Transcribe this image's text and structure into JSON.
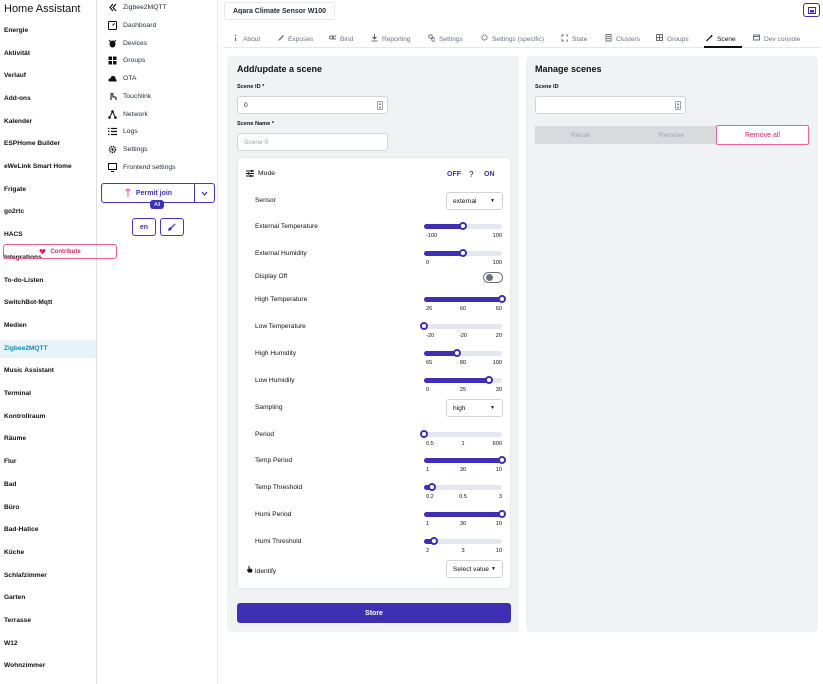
{
  "ha": {
    "title": "Home Assistant",
    "items": [
      "Energie",
      "Aktivität",
      "Verlauf",
      "Add-ons",
      "Kalender",
      "ESPHome Builder",
      "eWeLink Smart Home",
      "Frigate",
      "go2rtc",
      "HACS",
      "Integrations",
      "To-do-Listen",
      "SwitchBot-Mqtt",
      "Medien",
      "Zigbee2MQTT",
      "Music Assistant",
      "Terminal",
      "Kontrollraum",
      "Räume",
      "Flur",
      "Bad",
      "Büro",
      "Bad-Hatice",
      "Küche",
      "Schlafzimmer",
      "Garten",
      "Terrasse",
      "W12",
      "Wohnzimmer"
    ],
    "active_index": 14
  },
  "z2m": {
    "items": [
      {
        "label": "Zigbee2MQTT",
        "icon": "double-chevron-left-icon"
      },
      {
        "label": "Dashboard",
        "icon": "dashboard-icon"
      },
      {
        "label": "Devices",
        "icon": "bee-icon"
      },
      {
        "label": "Groups",
        "icon": "groups-icon"
      },
      {
        "label": "OTA",
        "icon": "cloud-icon"
      },
      {
        "label": "Touchlink",
        "icon": "touchlink-icon"
      },
      {
        "label": "Network",
        "icon": "network-icon"
      },
      {
        "label": "Logs",
        "icon": "list-icon"
      },
      {
        "label": "Settings",
        "icon": "gear-icon"
      },
      {
        "label": "Frontend settings",
        "icon": "monitor-icon"
      }
    ],
    "permit_join": "Permit join",
    "permit_badge": "All",
    "language": "en",
    "contribute": "Contribute"
  },
  "device_title": "Aqara Climate Sensor W100",
  "tabs": [
    {
      "label": "About",
      "icon": "info-icon"
    },
    {
      "label": "Exposes",
      "icon": "pencil-icon"
    },
    {
      "label": "Bind",
      "icon": "link-icon"
    },
    {
      "label": "Reporting",
      "icon": "download-icon"
    },
    {
      "label": "Settings",
      "icon": "gears-icon"
    },
    {
      "label": "Settings (specific)",
      "icon": "gear-icon"
    },
    {
      "label": "State",
      "icon": "state-icon"
    },
    {
      "label": "Clusters",
      "icon": "clusters-icon"
    },
    {
      "label": "Groups",
      "icon": "groups-icon"
    },
    {
      "label": "Scene",
      "icon": "wand-icon"
    },
    {
      "label": "Dev console",
      "icon": "console-icon"
    }
  ],
  "active_tab": "Scene",
  "add_scene": {
    "title": "Add/update a scene",
    "scene_id_label": "Scene ID *",
    "scene_id_value": "0",
    "scene_name_label": "Scene Name *",
    "scene_name_placeholder": "Scene 0",
    "mode_label": "Mode",
    "mode_off": "OFF",
    "mode_help": "?",
    "mode_on": "ON",
    "rows": [
      {
        "label": "Sensor",
        "kind": "select",
        "value": "external"
      },
      {
        "label": "External Temperature",
        "kind": "slider",
        "min": -100,
        "max": 100,
        "value": 0,
        "ticks": [
          "-100",
          "100"
        ]
      },
      {
        "label": "External Humidity",
        "kind": "slider",
        "min": 0,
        "max": 100,
        "value": 50,
        "ticks": [
          "0",
          "100"
        ]
      },
      {
        "label": "Display Off",
        "kind": "toggle",
        "value": false
      },
      {
        "label": "High Temperature",
        "kind": "slider",
        "min": 26,
        "max": 60,
        "value": 60,
        "ticks": [
          "26",
          "60",
          "60"
        ]
      },
      {
        "label": "Low Temperature",
        "kind": "slider",
        "min": -20,
        "max": 20,
        "value": -20,
        "ticks": [
          "-20",
          "-20",
          "20"
        ]
      },
      {
        "label": "High Humidity",
        "kind": "slider",
        "min": 65,
        "max": 100,
        "value": 80,
        "ticks": [
          "65",
          "80",
          "100"
        ]
      },
      {
        "label": "Low Humidity",
        "kind": "slider",
        "min": 0,
        "max": 30,
        "value": 25,
        "ticks": [
          "0",
          "25",
          "30"
        ]
      },
      {
        "label": "Sampling",
        "kind": "select",
        "value": "high"
      },
      {
        "label": "Period",
        "kind": "slider",
        "min": 0.5,
        "max": 600,
        "value": 1,
        "ticks": [
          "0.5",
          "1",
          "600"
        ]
      },
      {
        "label": "Temp Period",
        "kind": "slider",
        "min": 1,
        "max": 10,
        "value": 10,
        "ticks": [
          "1",
          "30",
          "10"
        ]
      },
      {
        "label": "Temp Threshold",
        "kind": "slider",
        "min": 0.2,
        "max": 3,
        "value": 0.5,
        "ticks": [
          "0.2",
          "0.5",
          "3"
        ]
      },
      {
        "label": "Humi Period",
        "kind": "slider",
        "min": 1,
        "max": 10,
        "value": 10,
        "ticks": [
          "1",
          "30",
          "10"
        ]
      },
      {
        "label": "Humi Threshold",
        "kind": "slider",
        "min": 2,
        "max": 10,
        "value": 3,
        "ticks": [
          "2",
          "3",
          "10"
        ]
      },
      {
        "label": "Identify",
        "kind": "select",
        "value": "Select value"
      }
    ],
    "store": "Store"
  },
  "manage": {
    "title": "Manage scenes",
    "scene_id_label": "Scene ID",
    "scene_id_value": "",
    "recall": "Recall",
    "remove": "Remove",
    "remove_all": "Remove all"
  }
}
